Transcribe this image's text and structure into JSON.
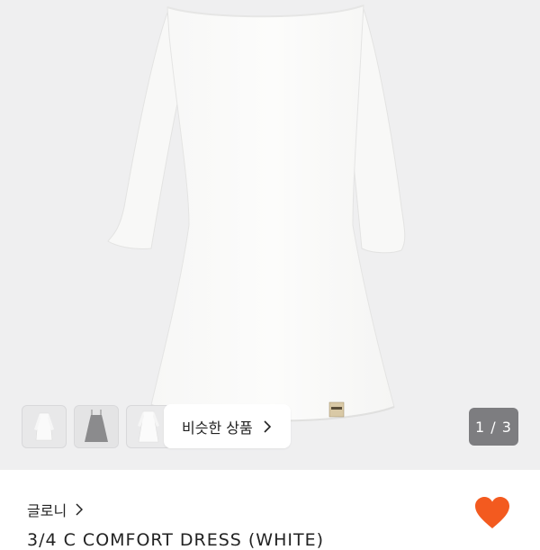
{
  "product": {
    "thumbnails": [
      {
        "name": "thumbnail-1",
        "icon": "dress-thumbnail-icon"
      },
      {
        "name": "thumbnail-2",
        "icon": "slip-dress-thumbnail-icon"
      },
      {
        "name": "thumbnail-3",
        "icon": "dress-thumbnail-icon"
      }
    ],
    "similar_button_label": "비슷한 상품",
    "image_counter": "1 / 3",
    "shop_name": "글로니",
    "title": "3/4 C COMFORT DRESS (WHITE)",
    "favorite_icon": "heart-icon"
  },
  "colors": {
    "heart": "#f35a1f",
    "image_background": "#efeff0",
    "counter_background": "#7d7d80"
  }
}
